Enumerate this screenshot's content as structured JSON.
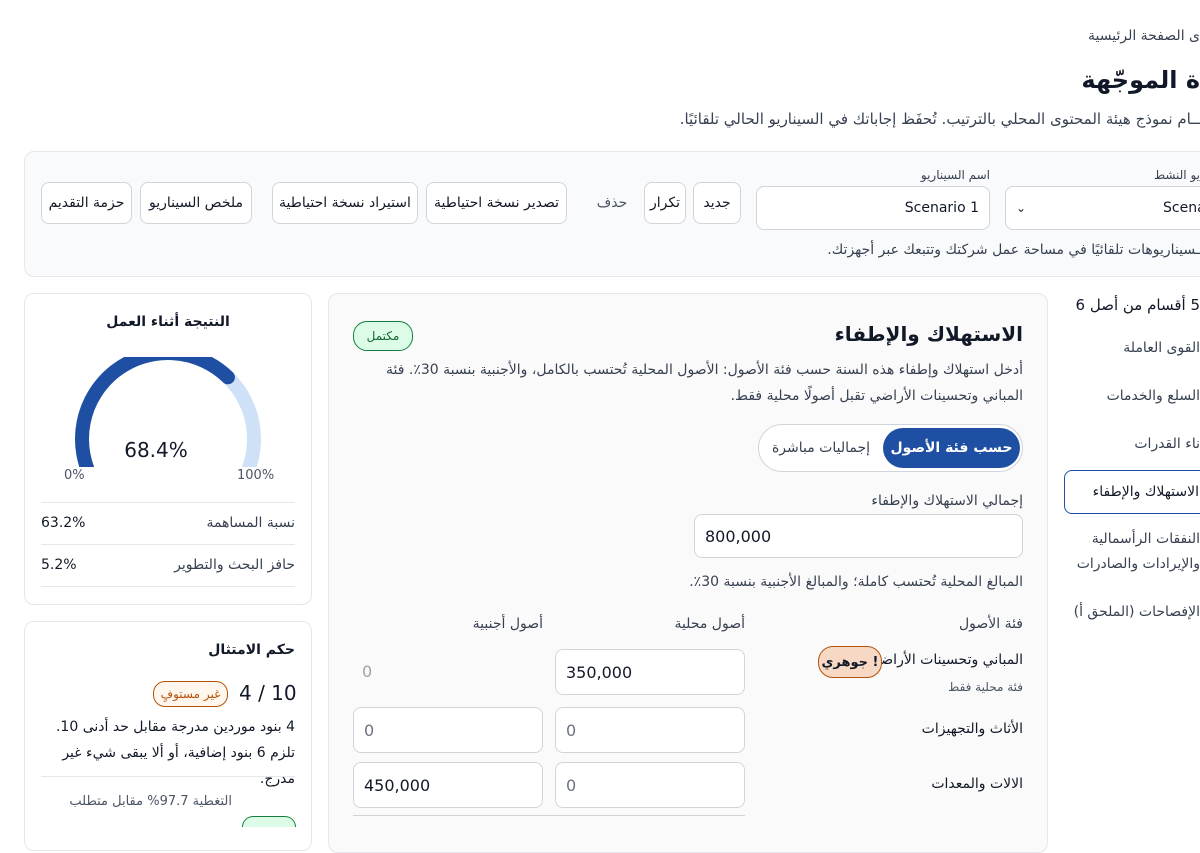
{
  "breadcrumb": "ى الصفحة الرئيسية",
  "page_title": "ة الموجّهة",
  "page_subtitle": "ــام نموذج هيئة المحتوى المحلي بالترتيب. تُحفَظ إجاباتك في السيناريو الحالي تلقائيًا.",
  "toolbar": {
    "active_label": "يو النشط",
    "active_value": "Scena",
    "name_label": "اسم السيناريو",
    "name_value": "Scenario 1",
    "new": "جديد",
    "duplicate": "تكرار",
    "delete": "حذف",
    "export_backup": "تصدير نسخة احتياطية",
    "import_backup": "استيراد نسخة احتياطية",
    "summary": "ملخص السيناريو",
    "submission": "حزمة التقديم",
    "note": "ـسيناريوهات تلقائيًا في مساحة عمل شركتك وتتبعك عبر أجهزتك."
  },
  "sidebar": {
    "progress": "5 أقسام من أصل 6",
    "items": [
      {
        "label": "القوى العاملة"
      },
      {
        "label": "السلع والخدمات"
      },
      {
        "label": "ناء القدرات"
      },
      {
        "label": "الاستهلاك والإطفاء"
      },
      {
        "label": "النفقات الرأسمالية"
      },
      {
        "label": "والإيرادات والصادرات"
      },
      {
        "label": "الإفصاحات (الملحق أ)"
      }
    ]
  },
  "section": {
    "title": "الاستهلاك والإطفاء",
    "status": "مكتمل",
    "desc": "أدخل استهلاك وإطفاء هذه السنة حسب فئة الأصول: الأصول المحلية تُحتسب بالكامل، والأجنبية بنسبة 30٪. فئة المباني وتحسينات الأراضي تقبل أصولًا محلية فقط.",
    "seg_active": "حسب فئة الأصول",
    "seg_inactive": "إجماليات مباشرة",
    "total_label": "إجمالي الاستهلاك والإطفاء",
    "total_value": "800,000",
    "note": "المبالغ المحلية تُحتسب كاملة؛ والمبالغ الأجنبية بنسبة 30٪.",
    "col_class": "فئة الأصول",
    "col_local": "أصول محلية",
    "col_foreign": "أصول أجنبية",
    "rows": [
      {
        "name": "المباني وتحسينات الأراضي",
        "sub": "فئة محلية فقط",
        "badge": "! جوهري",
        "local": "350,000",
        "foreign": "0"
      },
      {
        "name": "الأثاث والتجهيزات",
        "local": "0",
        "foreign": "0"
      },
      {
        "name": "الالات والمعدات",
        "local": "0",
        "foreign": "450,000"
      }
    ]
  },
  "score": {
    "title": "النتيجة أثناء العمل",
    "value": "68.4%",
    "fraction": 0.684,
    "min": "0%",
    "max": "100%",
    "rows": [
      {
        "label": "نسبة المساهمة",
        "value": "63.2%"
      },
      {
        "label": "حافز البحث والتطوير",
        "value": "5.2%"
      }
    ]
  },
  "compliance": {
    "title": "حكم الامتثال",
    "count": "4 / 10",
    "badge": "غير مستوفٍ",
    "text": "4 بنود موردين مدرجة مقابل حد أدنى 10. تلزم 6 بنود إضافية، أو ألا يبقى شيء غير مدرج.",
    "coverage": "التغطية 97.7% مقابل متطلب"
  },
  "colors": {
    "accent": "#1e4fa3",
    "accent_light": "#cfe1f7",
    "success_bg": "#dcfce7",
    "success_border": "#15803d",
    "warn_bg": "#f6d8c4",
    "warn_border": "#b45309"
  }
}
